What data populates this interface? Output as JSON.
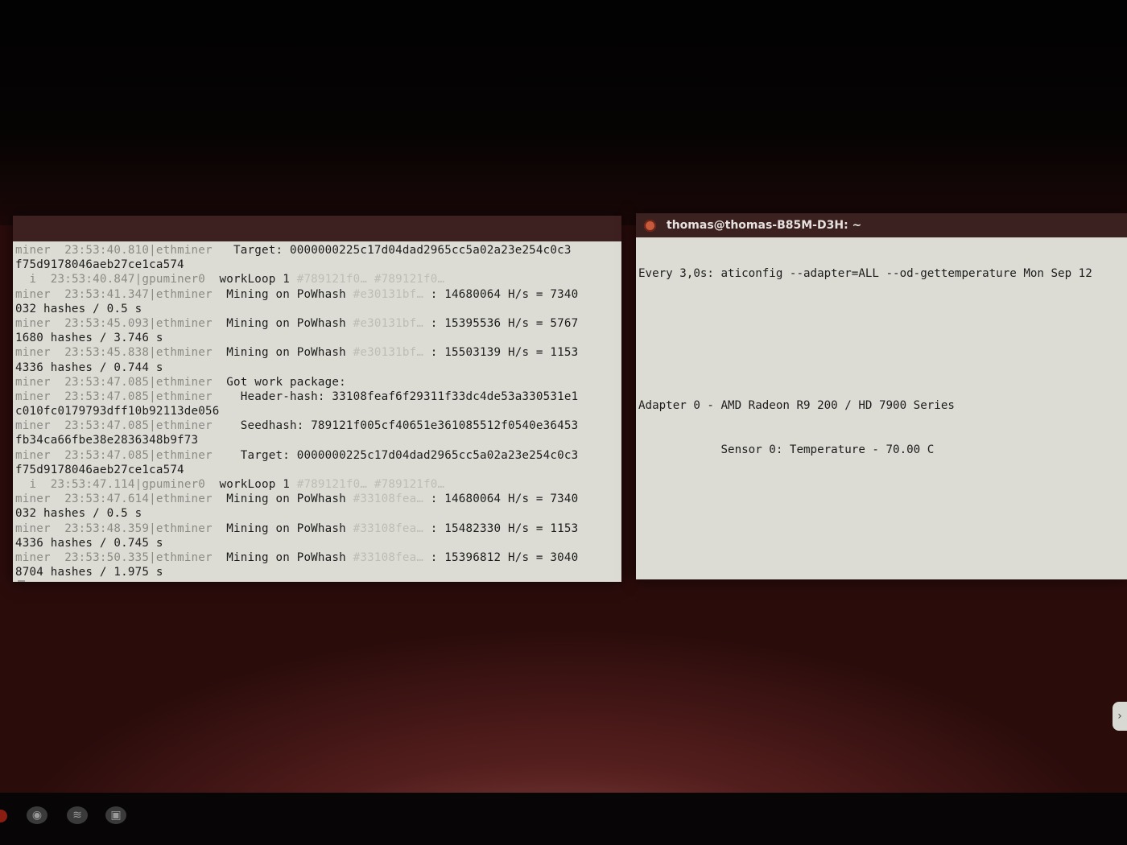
{
  "left_terminal": {
    "lines": [
      {
        "prefix": "miner",
        "time": "23:53:40.810",
        "source": "|ethminer",
        "msg": "   Target: ",
        "msg2": "0000000225c17d04dad2965cc5a02a23e254c0c3",
        "faint": ""
      },
      {
        "prefix": "",
        "time": "",
        "source": "",
        "msg": "f75d9178046aeb27ce1ca574",
        "msg2": "",
        "faint": ""
      },
      {
        "prefix": "  i",
        "time": "23:53:40.847",
        "source": "|gpuminer0",
        "msg": "  workLoop 1 ",
        "msg2": "",
        "faint": "#789121f0… #789121f0…"
      },
      {
        "prefix": "miner",
        "time": "23:53:41.347",
        "source": "|ethminer",
        "msg": "  Mining on PoWhash ",
        "msg2": " : 14680064 H/s = 7340",
        "faint": "#e30131bf…"
      },
      {
        "prefix": "",
        "time": "",
        "source": "",
        "msg": "032 hashes / 0.5 s",
        "msg2": "",
        "faint": ""
      },
      {
        "prefix": "miner",
        "time": "23:53:45.093",
        "source": "|ethminer",
        "msg": "  Mining on PoWhash ",
        "msg2": " : 15395536 H/s = 5767",
        "faint": "#e30131bf…"
      },
      {
        "prefix": "",
        "time": "",
        "source": "",
        "msg": "1680 hashes / 3.746 s",
        "msg2": "",
        "faint": ""
      },
      {
        "prefix": "miner",
        "time": "23:53:45.838",
        "source": "|ethminer",
        "msg": "  Mining on PoWhash ",
        "msg2": " : 15503139 H/s = 1153",
        "faint": "#e30131bf…"
      },
      {
        "prefix": "",
        "time": "",
        "source": "",
        "msg": "4336 hashes / 0.744 s",
        "msg2": "",
        "faint": ""
      },
      {
        "prefix": "miner",
        "time": "23:53:47.085",
        "source": "|ethminer",
        "msg": "  Got work package:",
        "msg2": "",
        "faint": ""
      },
      {
        "prefix": "miner",
        "time": "23:53:47.085",
        "source": "|ethminer",
        "msg": "    Header-hash: ",
        "msg2": "33108feaf6f29311f33dc4de53a330531e1",
        "faint": ""
      },
      {
        "prefix": "",
        "time": "",
        "source": "",
        "msg": "c010fc0179793dff10b92113de056",
        "msg2": "",
        "faint": ""
      },
      {
        "prefix": "miner",
        "time": "23:53:47.085",
        "source": "|ethminer",
        "msg": "    Seedhash: ",
        "msg2": "789121f005cf40651e361085512f0540e36453",
        "faint": ""
      },
      {
        "prefix": "",
        "time": "",
        "source": "",
        "msg": "fb34ca66fbe38e2836348b9f73",
        "msg2": "",
        "faint": ""
      },
      {
        "prefix": "miner",
        "time": "23:53:47.085",
        "source": "|ethminer",
        "msg": "    Target: ",
        "msg2": "0000000225c17d04dad2965cc5a02a23e254c0c3",
        "faint": ""
      },
      {
        "prefix": "",
        "time": "",
        "source": "",
        "msg": "f75d9178046aeb27ce1ca574",
        "msg2": "",
        "faint": ""
      },
      {
        "prefix": "  i",
        "time": "23:53:47.114",
        "source": "|gpuminer0",
        "msg": "  workLoop 1 ",
        "msg2": "",
        "faint": "#789121f0… #789121f0…"
      },
      {
        "prefix": "miner",
        "time": "23:53:47.614",
        "source": "|ethminer",
        "msg": "  Mining on PoWhash ",
        "msg2": " : 14680064 H/s = 7340",
        "faint": "#33108fea…"
      },
      {
        "prefix": "",
        "time": "",
        "source": "",
        "msg": "032 hashes / 0.5 s",
        "msg2": "",
        "faint": ""
      },
      {
        "prefix": "miner",
        "time": "23:53:48.359",
        "source": "|ethminer",
        "msg": "  Mining on PoWhash ",
        "msg2": " : 15482330 H/s = 1153",
        "faint": "#33108fea…"
      },
      {
        "prefix": "",
        "time": "",
        "source": "",
        "msg": "4336 hashes / 0.745 s",
        "msg2": "",
        "faint": ""
      },
      {
        "prefix": "miner",
        "time": "23:53:50.335",
        "source": "|ethminer",
        "msg": "  Mining on PoWhash ",
        "msg2": " : 15396812 H/s = 3040",
        "faint": "#33108fea…"
      },
      {
        "prefix": "",
        "time": "",
        "source": "",
        "msg": "8704 hashes / 1.975 s",
        "msg2": "",
        "faint": ""
      }
    ]
  },
  "right_terminal": {
    "title": "thomas@thomas-B85M-D3H: ~",
    "watch_header": "Every 3,0s: aticonfig --adapter=ALL --od-gettemperature Mon Sep 12",
    "adapter_line": "Adapter 0 - AMD Radeon R9 200 / HD 7900 Series",
    "sensor_line": "            Sensor 0: Temperature - 70.00 C"
  },
  "taskbar": {
    "icons": [
      "chromium-icon",
      "spotify-icon",
      "terminal-icon"
    ]
  },
  "colors": {
    "terminal_bg": "#dcdcd4",
    "titlebar": "#3b2120",
    "desktop": "#6e2d2c"
  }
}
